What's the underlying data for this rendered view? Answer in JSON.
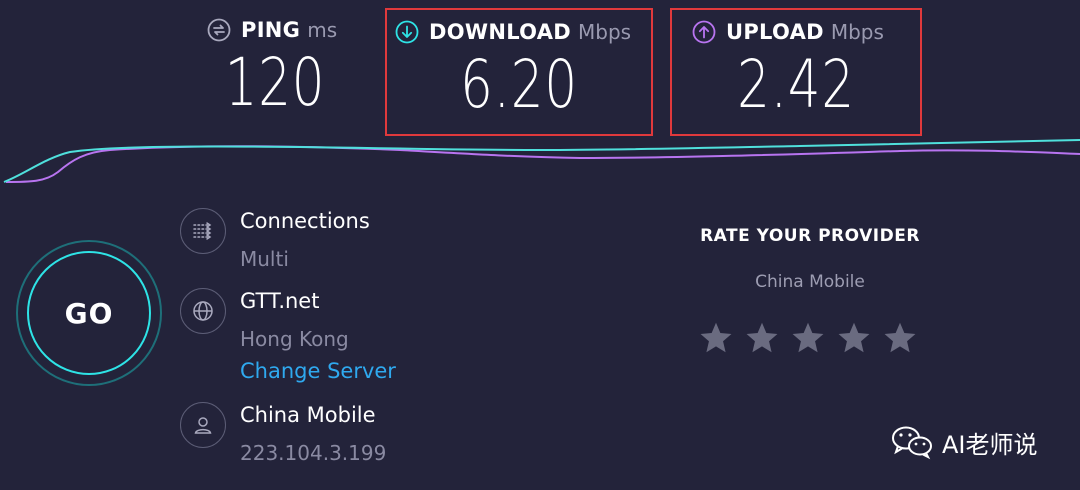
{
  "metrics": {
    "ping": {
      "label": "PING",
      "unit": "ms",
      "value": "120",
      "icon": "ping-icon"
    },
    "download": {
      "label": "DOWNLOAD",
      "unit": "Mbps",
      "value": "6.20",
      "icon": "download-arrow-icon",
      "color": "#2ee3e6"
    },
    "upload": {
      "label": "UPLOAD",
      "unit": "Mbps",
      "value": "2.42",
      "icon": "upload-arrow-icon",
      "color": "#b874f0"
    }
  },
  "go_button": {
    "label": "GO"
  },
  "connections": {
    "title": "Connections",
    "value": "Multi",
    "icon": "connections-icon"
  },
  "server": {
    "title": "GTT.net",
    "location": "Hong Kong",
    "change_link": "Change Server",
    "icon": "globe-icon"
  },
  "isp": {
    "title": "China Mobile",
    "ip": "223.104.3.199",
    "icon": "user-icon"
  },
  "rating": {
    "title": "RATE YOUR PROVIDER",
    "provider": "China Mobile",
    "stars_total": 5,
    "stars_selected": 0
  },
  "watermark": {
    "text": "AI老师说",
    "icon": "wechat-icon"
  },
  "colors": {
    "background": "#23233a",
    "accent_cyan": "#2ee3e6",
    "accent_purple": "#b874f0",
    "link": "#2fa9ef",
    "highlight_box": "#e0393c"
  }
}
